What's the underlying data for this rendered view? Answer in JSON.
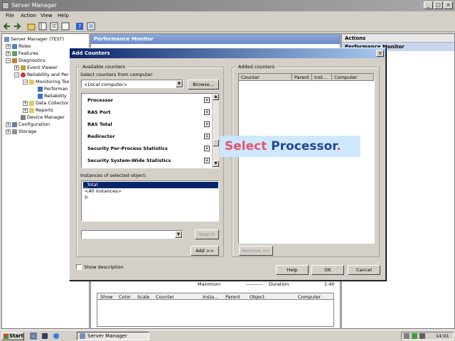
{
  "window": {
    "title": "Server Manager",
    "controls": [
      "_",
      "□",
      "×"
    ]
  },
  "menu": [
    "File",
    "Action",
    "View",
    "Help"
  ],
  "toolbar": {
    "icons": [
      "back-icon",
      "forward-icon",
      "up-icon",
      "show-hide-tree-icon",
      "properties-icon",
      "export-icon",
      "help-icon",
      "view-icon"
    ]
  },
  "tree": {
    "items": [
      {
        "label": "Server Manager (TEST)",
        "expander": ""
      },
      {
        "label": "Roles",
        "expander": "+"
      },
      {
        "label": "Features",
        "expander": "+"
      },
      {
        "label": "Diagnostics",
        "expander": "−"
      },
      {
        "label": "Event Viewer",
        "expander": "+"
      },
      {
        "label": "Reliability and Perf",
        "expander": "−"
      },
      {
        "label": "Monitoring Too",
        "expander": "−"
      },
      {
        "label": "Performan",
        "expander": ""
      },
      {
        "label": "Reliability",
        "expander": ""
      },
      {
        "label": "Data Collector",
        "expander": "+"
      },
      {
        "label": "Reports",
        "expander": "+"
      },
      {
        "label": "Device Manager",
        "expander": ""
      },
      {
        "label": "Configuration",
        "expander": "+"
      },
      {
        "label": "Storage",
        "expander": "+"
      }
    ]
  },
  "center": {
    "header": "Performance Monitor",
    "stats": {
      "maximum_label": "Maximum",
      "maximum_value": "----------",
      "duration_label": "Duration",
      "duration_value": "1:40"
    },
    "columns": [
      "Show",
      "Color",
      "Scale",
      "Counter",
      "Insta...",
      "Parent",
      "Object",
      "Computer"
    ]
  },
  "actions": {
    "header": "Actions",
    "sub": "Performance Monitor"
  },
  "dialog": {
    "title": "Add Counters",
    "available_label": "Available counters",
    "select_from_label": "Select counters from computer:",
    "computer_value": "<Local computer>",
    "browse_label": "Browse...",
    "objects": [
      "Processor",
      "RAS Port",
      "RAS Total",
      "Redirector",
      "Security Per-Process Statistics",
      "Security System-Wide Statistics"
    ],
    "instances_label": "Instances of selected object:",
    "instances": [
      "_Total",
      "<All instances>",
      "0"
    ],
    "search_label": "Search",
    "add_label": "Add >>",
    "added_label": "Added counters",
    "added_columns": [
      "Counter",
      "Parent",
      "Inst...",
      "Computer"
    ],
    "remove_label": "Remove <<",
    "show_description_label": "Show description",
    "help_label": "Help",
    "ok_label": "OK",
    "cancel_label": "Cancel"
  },
  "callout": {
    "word1": "Select",
    "word2": "Processor",
    "word3": "."
  },
  "taskbar": {
    "start_label": "Start",
    "task_label": "Server Manager",
    "clock": "14:01"
  }
}
